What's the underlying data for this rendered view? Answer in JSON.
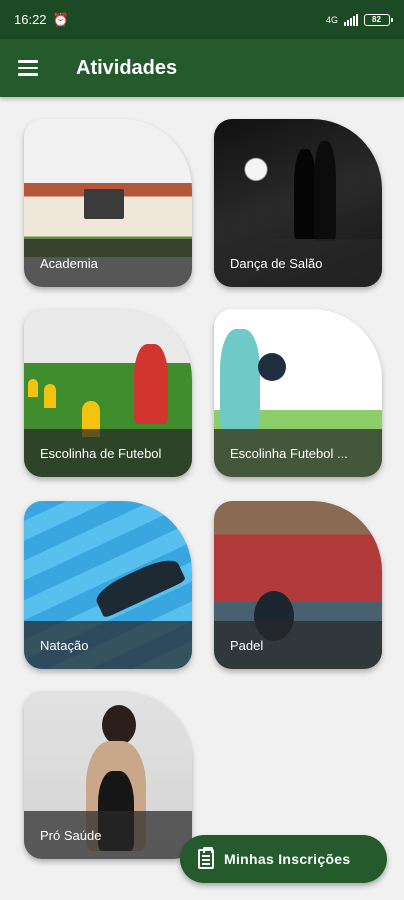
{
  "status_bar": {
    "time": "16:22",
    "network": "4G",
    "battery": "82"
  },
  "app_bar": {
    "title": "Atividades"
  },
  "activities": [
    {
      "label": "Academia"
    },
    {
      "label": "Dança de Salão"
    },
    {
      "label": "Escolinha de Futebol"
    },
    {
      "label": "Escolinha Futebol ..."
    },
    {
      "label": "Natação"
    },
    {
      "label": "Padel"
    },
    {
      "label": "Pró Saúde"
    }
  ],
  "fab": {
    "label": "Minhas Inscrições",
    "icon": "clipboard-icon"
  },
  "colors": {
    "primary": "#245a2c",
    "status_bar": "#1c4a24",
    "background": "#f1f1f1"
  }
}
